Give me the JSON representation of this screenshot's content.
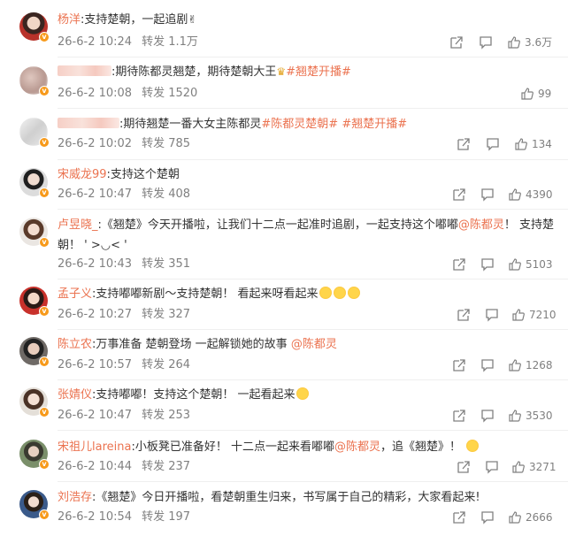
{
  "comments": [
    {
      "user": "杨洋",
      "text": ":支持楚朝，一起追剧",
      "date": "26-6-2 10:24",
      "repost": "转发 1.1万",
      "likes": "3.6万"
    },
    {
      "user": "",
      "text": ":期待陈都灵翘楚，期待楚朝大王",
      "tag": "#翘楚开播#",
      "date": "26-6-2 10:08",
      "repost": "转发 1520",
      "likes": "99"
    },
    {
      "user": "",
      "text": ":期待翘楚一番大女主陈都灵",
      "tag": "#陈都灵楚朝#",
      "tag2": "#翘楚开播#",
      "date": "26-6-2 10:02",
      "repost": "转发 785",
      "likes": "134"
    },
    {
      "user": "宋威龙99",
      "text": ":支持这个楚朝",
      "date": "26-6-2 10:47",
      "repost": "转发 408",
      "likes": "4390"
    },
    {
      "user": "卢昱晓_",
      "text": ":《翘楚》今天开播啦，让我们十二点一起准时追剧，一起支持这个嘟嘟",
      "mention": "@陈都灵",
      "text2": "！ 支持楚朝！ ' >◡< '",
      "date": "26-6-2 10:43",
      "repost": "转发 351",
      "likes": "5103"
    },
    {
      "user": "孟子义",
      "text": ":支持嘟嘟新剧～支持楚朝！ 看起来呀看起来",
      "date": "26-6-2 10:27",
      "repost": "转发 327",
      "likes": "7210"
    },
    {
      "user": "陈立农",
      "text": ":万事准备 楚朝登场 一起解锁她的故事",
      "mention": "@陈都灵",
      "date": "26-6-2 10:57",
      "repost": "转发 264",
      "likes": "1268"
    },
    {
      "user": "张婧仪",
      "text": ":支持嘟嘟！支持这个楚朝！ 一起看起来",
      "date": "26-6-2 10:47",
      "repost": "转发 253",
      "likes": "3530"
    },
    {
      "user": "宋祖儿lareina",
      "text": ":小板凳已准备好！ 十二点一起来看嘟嘟",
      "mention": "@陈都灵",
      "text2": "，追《翘楚》！",
      "date": "26-6-2 10:44",
      "repost": "转发 237",
      "likes": "3271"
    },
    {
      "user": "刘浩存",
      "text": ":《翘楚》今日开播啦，看楚朝重生归来，书写属于自己的精彩，大家看起来!",
      "date": "26-6-2 10:54",
      "repost": "转发 197",
      "likes": "2666"
    }
  ],
  "colors": {
    "name": "#eb7350",
    "text": "#333333",
    "meta": "#808080",
    "badge": "#f79a1b"
  }
}
